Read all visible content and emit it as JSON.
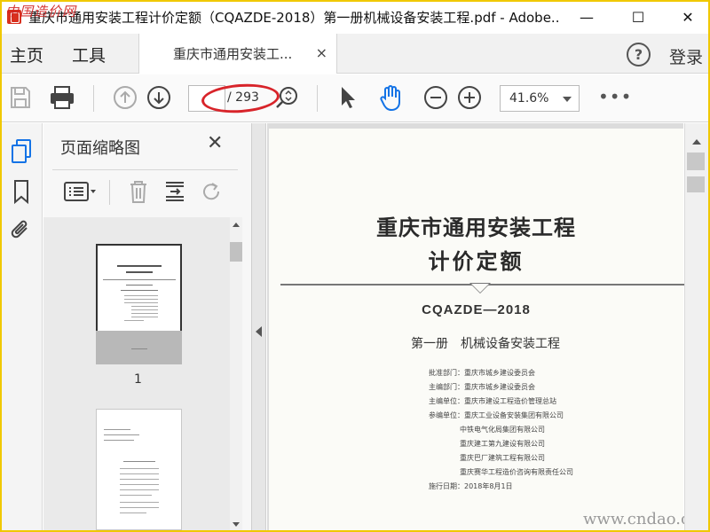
{
  "titlebar": {
    "title": "重庆市通用安装工程计价定额（CQAZDE-2018）第一册机械设备安装工程.pdf - Adobe...",
    "watermark": "中国造价网",
    "minimize": "—",
    "maximize": "☐",
    "close": "✕"
  },
  "menu": {
    "home": "主页",
    "tools": "工具",
    "tab_label": "重庆市通用安装工...",
    "tab_close": "×",
    "help": "?",
    "login": "登录"
  },
  "toolbar": {
    "page_current": "",
    "page_total": "/ 293",
    "zoom": "41.6%",
    "more": "•••",
    "highlight_color": "#d8242a",
    "accent_color": "#1473e6"
  },
  "panel": {
    "title": "页面缩略图",
    "close": "✕",
    "thumb1_label": "1"
  },
  "document": {
    "title_line1": "重庆市通用安装工程",
    "title_line2": "计价定额",
    "code": "CQAZDE—2018",
    "volume": "第一册　机械设备安装工程",
    "lines": [
      "批准部门：重庆市城乡建设委员会",
      "主编部门：重庆市城乡建设委员会",
      "主编单位：重庆市建设工程造价管理总站",
      "参编单位：重庆工业设备安装集团有限公司",
      "中铁电气化局集团有限公司",
      "重庆建工第九建设有限公司",
      "重庆巴厂建筑工程有限公司",
      "重庆赛华工程造价咨询有限责任公司",
      "施行日期：2018年8月1日"
    ],
    "watermark": "www.cndao.com"
  }
}
